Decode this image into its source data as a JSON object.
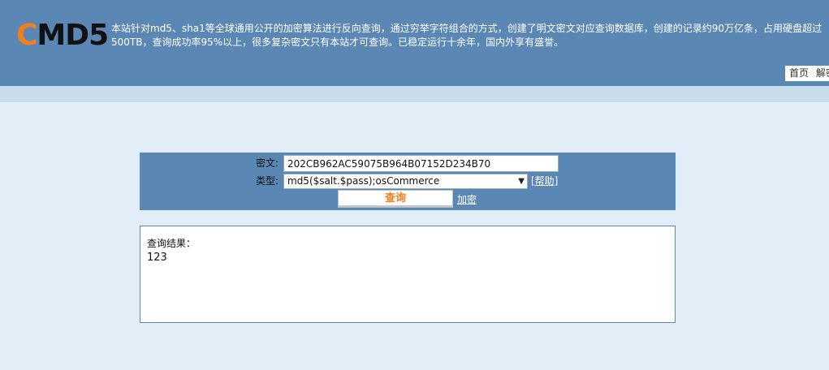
{
  "header": {
    "logo_first": "C",
    "logo_rest": "MD5",
    "intro": "本站针对md5、sha1等全球通用公开的加密算法进行反向查询，通过穷举字符组合的方式，创建了明文密文对应查询数据库，创建的记录约90万亿条，占用硬盘超过500TB，查询成功率95%以上，很多复杂密文只有本站才可查询。已稳定运行十余年，国内外享有盛誉。",
    "nav": [
      "首页",
      "解密"
    ]
  },
  "form": {
    "cipher_label": "密文:",
    "cipher_value": "202CB962AC59075B964B07152D234B70",
    "type_label": "类型:",
    "type_value": "md5($salt.$pass);osCommerce",
    "help_label": "[帮助]",
    "query_button": "查询",
    "encrypt_link": "加密"
  },
  "result": {
    "title": "查询结果：",
    "value": "123"
  },
  "colors": {
    "header_bg": "#5b87b4",
    "accent": "#f07f1c",
    "page_bg": "#e2eef7"
  }
}
